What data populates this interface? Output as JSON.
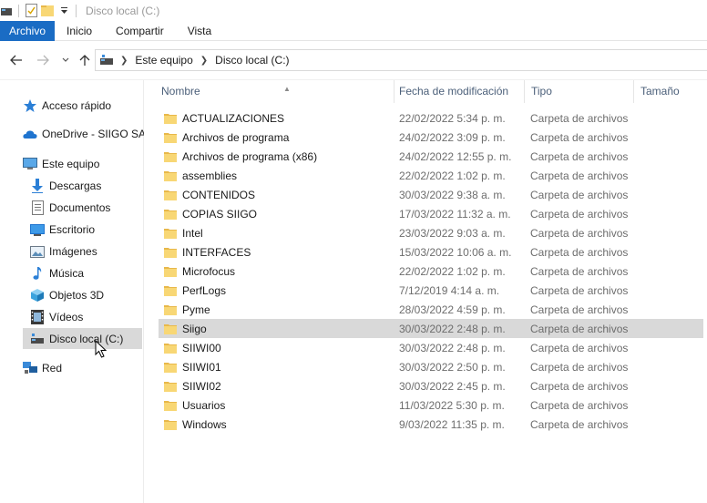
{
  "window": {
    "title": "Disco local (C:)"
  },
  "ribbon": {
    "tabs": [
      "Archivo",
      "Inicio",
      "Compartir",
      "Vista"
    ],
    "active": "Archivo"
  },
  "address": {
    "crumbs": [
      "Este equipo",
      "Disco local (C:)"
    ]
  },
  "sidebar": {
    "items": [
      {
        "label": "Acceso rápido",
        "icon": "star-icon"
      },
      {
        "label": "OneDrive - SIIGO SAS",
        "icon": "cloud-icon"
      },
      {
        "label": "Este equipo",
        "icon": "computer-icon"
      },
      {
        "label": "Descargas",
        "icon": "download-icon"
      },
      {
        "label": "Documentos",
        "icon": "document-icon"
      },
      {
        "label": "Escritorio",
        "icon": "desktop-icon"
      },
      {
        "label": "Imágenes",
        "icon": "pictures-icon"
      },
      {
        "label": "Música",
        "icon": "music-icon"
      },
      {
        "label": "Objetos 3D",
        "icon": "cube-icon"
      },
      {
        "label": "Vídeos",
        "icon": "video-icon"
      },
      {
        "label": "Disco local (C:)",
        "icon": "drive-icon",
        "selected": true
      },
      {
        "label": "Red",
        "icon": "network-icon"
      }
    ]
  },
  "filelist": {
    "columns": {
      "name": "Nombre",
      "date": "Fecha de modificación",
      "type": "Tipo",
      "size": "Tamaño"
    },
    "rows": [
      {
        "name": "ACTUALIZACIONES",
        "date": "22/02/2022 5:34 p. m.",
        "type": "Carpeta de archivos"
      },
      {
        "name": "Archivos de programa",
        "date": "24/02/2022 3:09 p. m.",
        "type": "Carpeta de archivos"
      },
      {
        "name": "Archivos de programa (x86)",
        "date": "24/02/2022 12:55 p. m.",
        "type": "Carpeta de archivos"
      },
      {
        "name": "assemblies",
        "date": "22/02/2022 1:02 p. m.",
        "type": "Carpeta de archivos"
      },
      {
        "name": "CONTENIDOS",
        "date": "30/03/2022 9:38 a. m.",
        "type": "Carpeta de archivos"
      },
      {
        "name": "COPIAS SIIGO",
        "date": "17/03/2022 11:32 a. m.",
        "type": "Carpeta de archivos"
      },
      {
        "name": "Intel",
        "date": "23/03/2022 9:03 a. m.",
        "type": "Carpeta de archivos"
      },
      {
        "name": "INTERFACES",
        "date": "15/03/2022 10:06 a. m.",
        "type": "Carpeta de archivos"
      },
      {
        "name": "Microfocus",
        "date": "22/02/2022 1:02 p. m.",
        "type": "Carpeta de archivos"
      },
      {
        "name": "PerfLogs",
        "date": "7/12/2019 4:14 a. m.",
        "type": "Carpeta de archivos"
      },
      {
        "name": "Pyme",
        "date": "28/03/2022 4:59 p. m.",
        "type": "Carpeta de archivos"
      },
      {
        "name": "Siigo",
        "date": "30/03/2022 2:48 p. m.",
        "type": "Carpeta de archivos",
        "selected": true
      },
      {
        "name": "SIIWI00",
        "date": "30/03/2022 2:48 p. m.",
        "type": "Carpeta de archivos"
      },
      {
        "name": "SIIWI01",
        "date": "30/03/2022 2:50 p. m.",
        "type": "Carpeta de archivos"
      },
      {
        "name": "SIIWI02",
        "date": "30/03/2022 2:45 p. m.",
        "type": "Carpeta de archivos"
      },
      {
        "name": "Usuarios",
        "date": "11/03/2022 5:30 p. m.",
        "type": "Carpeta de archivos"
      },
      {
        "name": "Windows",
        "date": "9/03/2022 11:35 p. m.",
        "type": "Carpeta de archivos"
      }
    ]
  },
  "colors": {
    "accent": "#1a6cc4",
    "folder": "#f8d775",
    "folder_dark": "#e8b84a",
    "selection": "#d9d9d9"
  }
}
